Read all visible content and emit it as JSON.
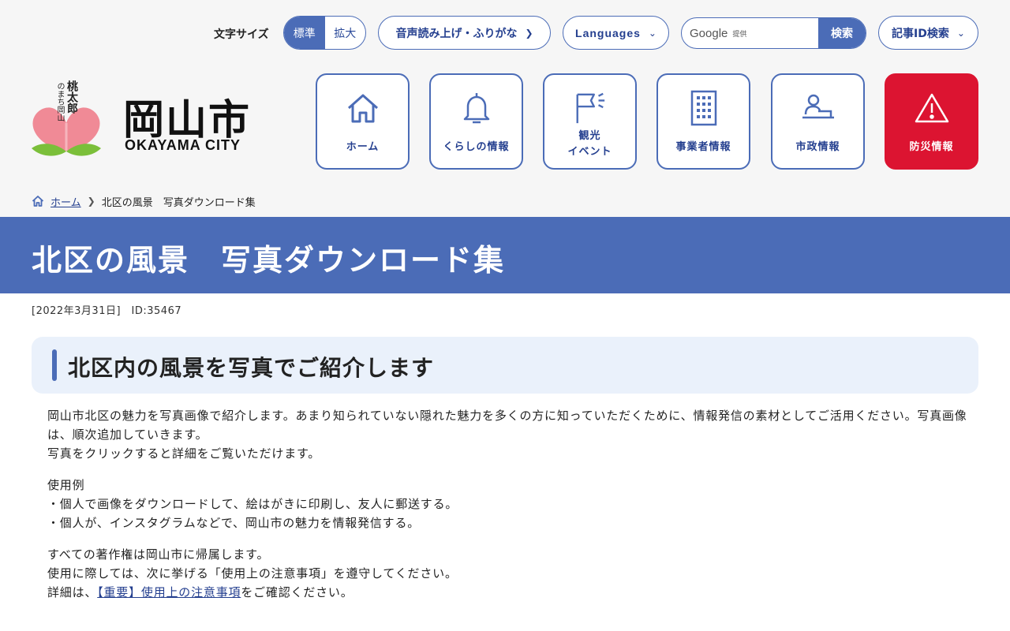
{
  "utility": {
    "font_size_label": "文字サイズ",
    "font_size_standard": "標準",
    "font_size_large": "拡大",
    "read_aloud": "音声読み上げ・ふりがな",
    "languages": "Languages",
    "search_google": "Google",
    "search_provided": "提供",
    "search_button": "検索",
    "article_id_search": "記事ID検索"
  },
  "logo": {
    "vertical_small": "のまち岡山",
    "vertical_large": "桃太郎",
    "city_jp": "岡山市",
    "city_en": "OKAYAMA CITY"
  },
  "nav": [
    {
      "label": "ホーム",
      "icon": "home-icon"
    },
    {
      "label": "くらしの情報",
      "icon": "bell-icon"
    },
    {
      "label": "観光\nイベント",
      "icon": "flag-icon"
    },
    {
      "label": "事業者情報",
      "icon": "building-icon"
    },
    {
      "label": "市政情報",
      "icon": "podium-icon"
    },
    {
      "label": "防災情報",
      "icon": "warning-icon"
    }
  ],
  "breadcrumb": {
    "home": "ホーム",
    "current": "北区の風景　写真ダウンロード集"
  },
  "page": {
    "title": "北区の風景　写真ダウンロード集",
    "meta": "[2022年3月31日]　ID:35467",
    "heading": "北区内の風景を写真でご紹介します"
  },
  "body": {
    "p1_l1": "岡山市北区の魅力を写真画像で紹介します。あまり知られていない隠れた魅力を多くの方に知っていただくために、情報発信の素材としてご活用ください。写真画像は、順次追加していきます。",
    "p1_l2": "写真をクリックすると詳細をご覧いただけます。",
    "p2_l1": "使用例",
    "p2_l2": "・個人で画像をダウンロードして、絵はがきに印刷し、友人に郵送する。",
    "p2_l3": "・個人が、インスタグラムなどで、岡山市の魅力を情報発信する。",
    "p3_l1": "すべての著作権は岡山市に帰属します。",
    "p3_l2": "使用に際しては、次に挙げる「使用上の注意事項」を遵守してください。",
    "p3_l3_pre": "詳細は、",
    "p3_l3_link": "【重要】使用上の注意事項",
    "p3_l3_post": "をご確認ください。"
  },
  "colors": {
    "primary": "#4b6cb7",
    "danger": "#dc1431",
    "heading_bg": "#eaf1fb"
  }
}
